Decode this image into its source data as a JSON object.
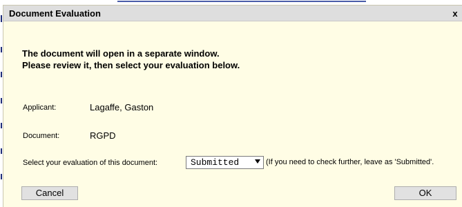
{
  "dialog": {
    "title": "Document Evaluation",
    "close_glyph": "x"
  },
  "intro": {
    "line1": "The document will open in a separate window.",
    "line2": "Please review it, then select your evaluation below."
  },
  "fields": {
    "applicant_label": "Applicant:",
    "applicant_value": "Lagaffe, Gaston",
    "document_label": "Document:",
    "document_value": "RGPD",
    "evaluation_label": "Select your evaluation of this document:",
    "evaluation_selected": "Submitted",
    "evaluation_hint": "(If you need to check further, leave as 'Submitted'."
  },
  "buttons": {
    "cancel": "Cancel",
    "ok": "OK"
  }
}
